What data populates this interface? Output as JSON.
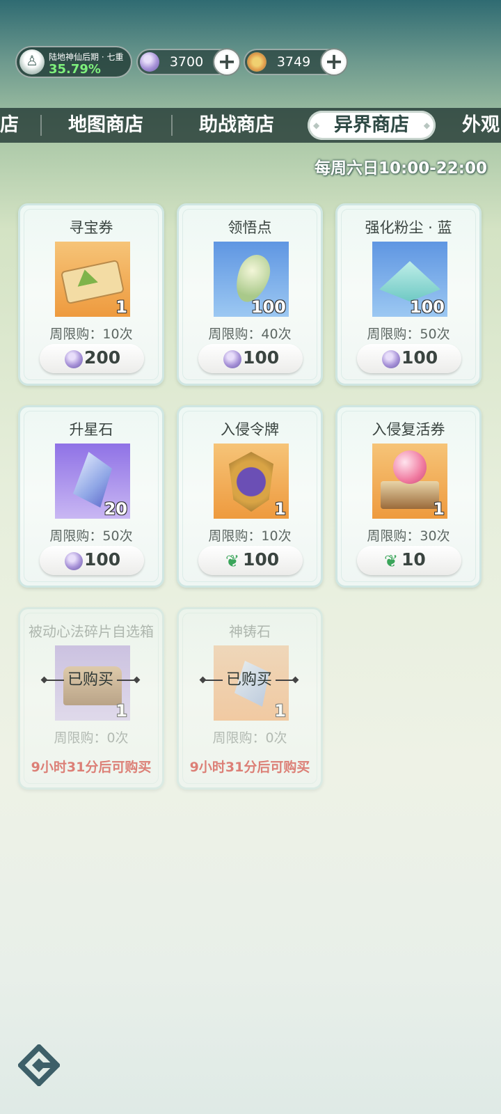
{
  "status": {
    "realm_name": "陆地神仙后期 · 七重",
    "realm_progress": "35.79%",
    "currency1": {
      "icon": "jade-coin-icon",
      "value": "3700",
      "plus": "+"
    },
    "currency2": {
      "icon": "gold-leaf-coin-icon",
      "value": "3749",
      "plus": "+"
    }
  },
  "tabs": {
    "t1": "店",
    "t2": "地图商店",
    "t3": "助战商店",
    "active": "异界商店",
    "t5": "外观"
  },
  "schedule": "每周六日10:00-22:00",
  "items": [
    {
      "name": "寻宝券",
      "qty": "1",
      "limit": "周限购：10次",
      "price": "200",
      "currency": "jade-coin-icon"
    },
    {
      "name": "领悟点",
      "qty": "100",
      "limit": "周限购：40次",
      "price": "100",
      "currency": "jade-coin-icon"
    },
    {
      "name": "强化粉尘 · 蓝",
      "qty": "100",
      "limit": "周限购：50次",
      "price": "100",
      "currency": "jade-coin-icon"
    },
    {
      "name": "升星石",
      "qty": "20",
      "limit": "周限购：50次",
      "price": "100",
      "currency": "jade-coin-icon"
    },
    {
      "name": "入侵令牌",
      "qty": "1",
      "limit": "周限购：10次",
      "price": "100",
      "currency": "leaf-icon"
    },
    {
      "name": "入侵复活券",
      "qty": "1",
      "limit": "周限购：30次",
      "price": "10",
      "currency": "leaf-icon"
    },
    {
      "name": "被动心法碎片自选箱",
      "qty": "1",
      "limit": "周限购：0次",
      "sold": "已购买",
      "timer": "9小时31分后可购买"
    },
    {
      "name": "神铸石",
      "qty": "1",
      "limit": "周限购：0次",
      "sold": "已购买",
      "timer": "9小时31分后可购买"
    }
  ],
  "colors": {
    "accent_green": "#7ef07c",
    "timer_red": "#d63c35",
    "tabbar": "#263c37"
  }
}
